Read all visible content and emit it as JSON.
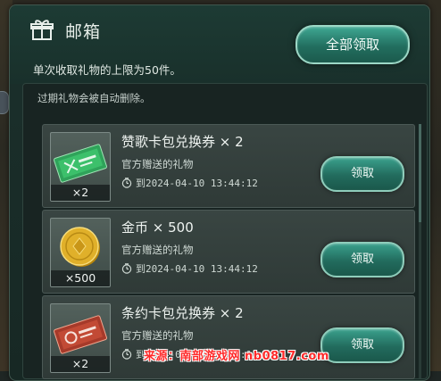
{
  "mailbox": {
    "title": "邮箱",
    "claim_all_label": "全部领取",
    "limit_note": "单次收取礼物的上限为50件。",
    "expire_note": "过期礼物会被自动删除。"
  },
  "items": [
    {
      "name": "赞歌卡包兑换券 × 2",
      "sub": "官方赠送的礼物",
      "expire": "到2024-04-10  13:44:12",
      "count": "×2",
      "thumb_icon": "green-voucher-icon",
      "claim_label": "领取"
    },
    {
      "name": "金币  × 500",
      "sub": "官方赠送的礼物",
      "expire": "到2024-04-10  13:44:12",
      "count": "×500",
      "thumb_icon": "gold-coin-icon",
      "claim_label": "领取"
    },
    {
      "name": "条约卡包兑换券 × 2",
      "sub": "官方赠送的礼物",
      "expire": "到2024-04-10  13:44:12",
      "count": "×2",
      "thumb_icon": "red-voucher-icon",
      "claim_label": "领取"
    }
  ],
  "watermark": "来源：南部游戏网 nb0817.com",
  "colors": {
    "panel": "#1b302c",
    "accent": "#3fa893",
    "item_bg": "#394542",
    "watermark": "#ff2a2a"
  }
}
